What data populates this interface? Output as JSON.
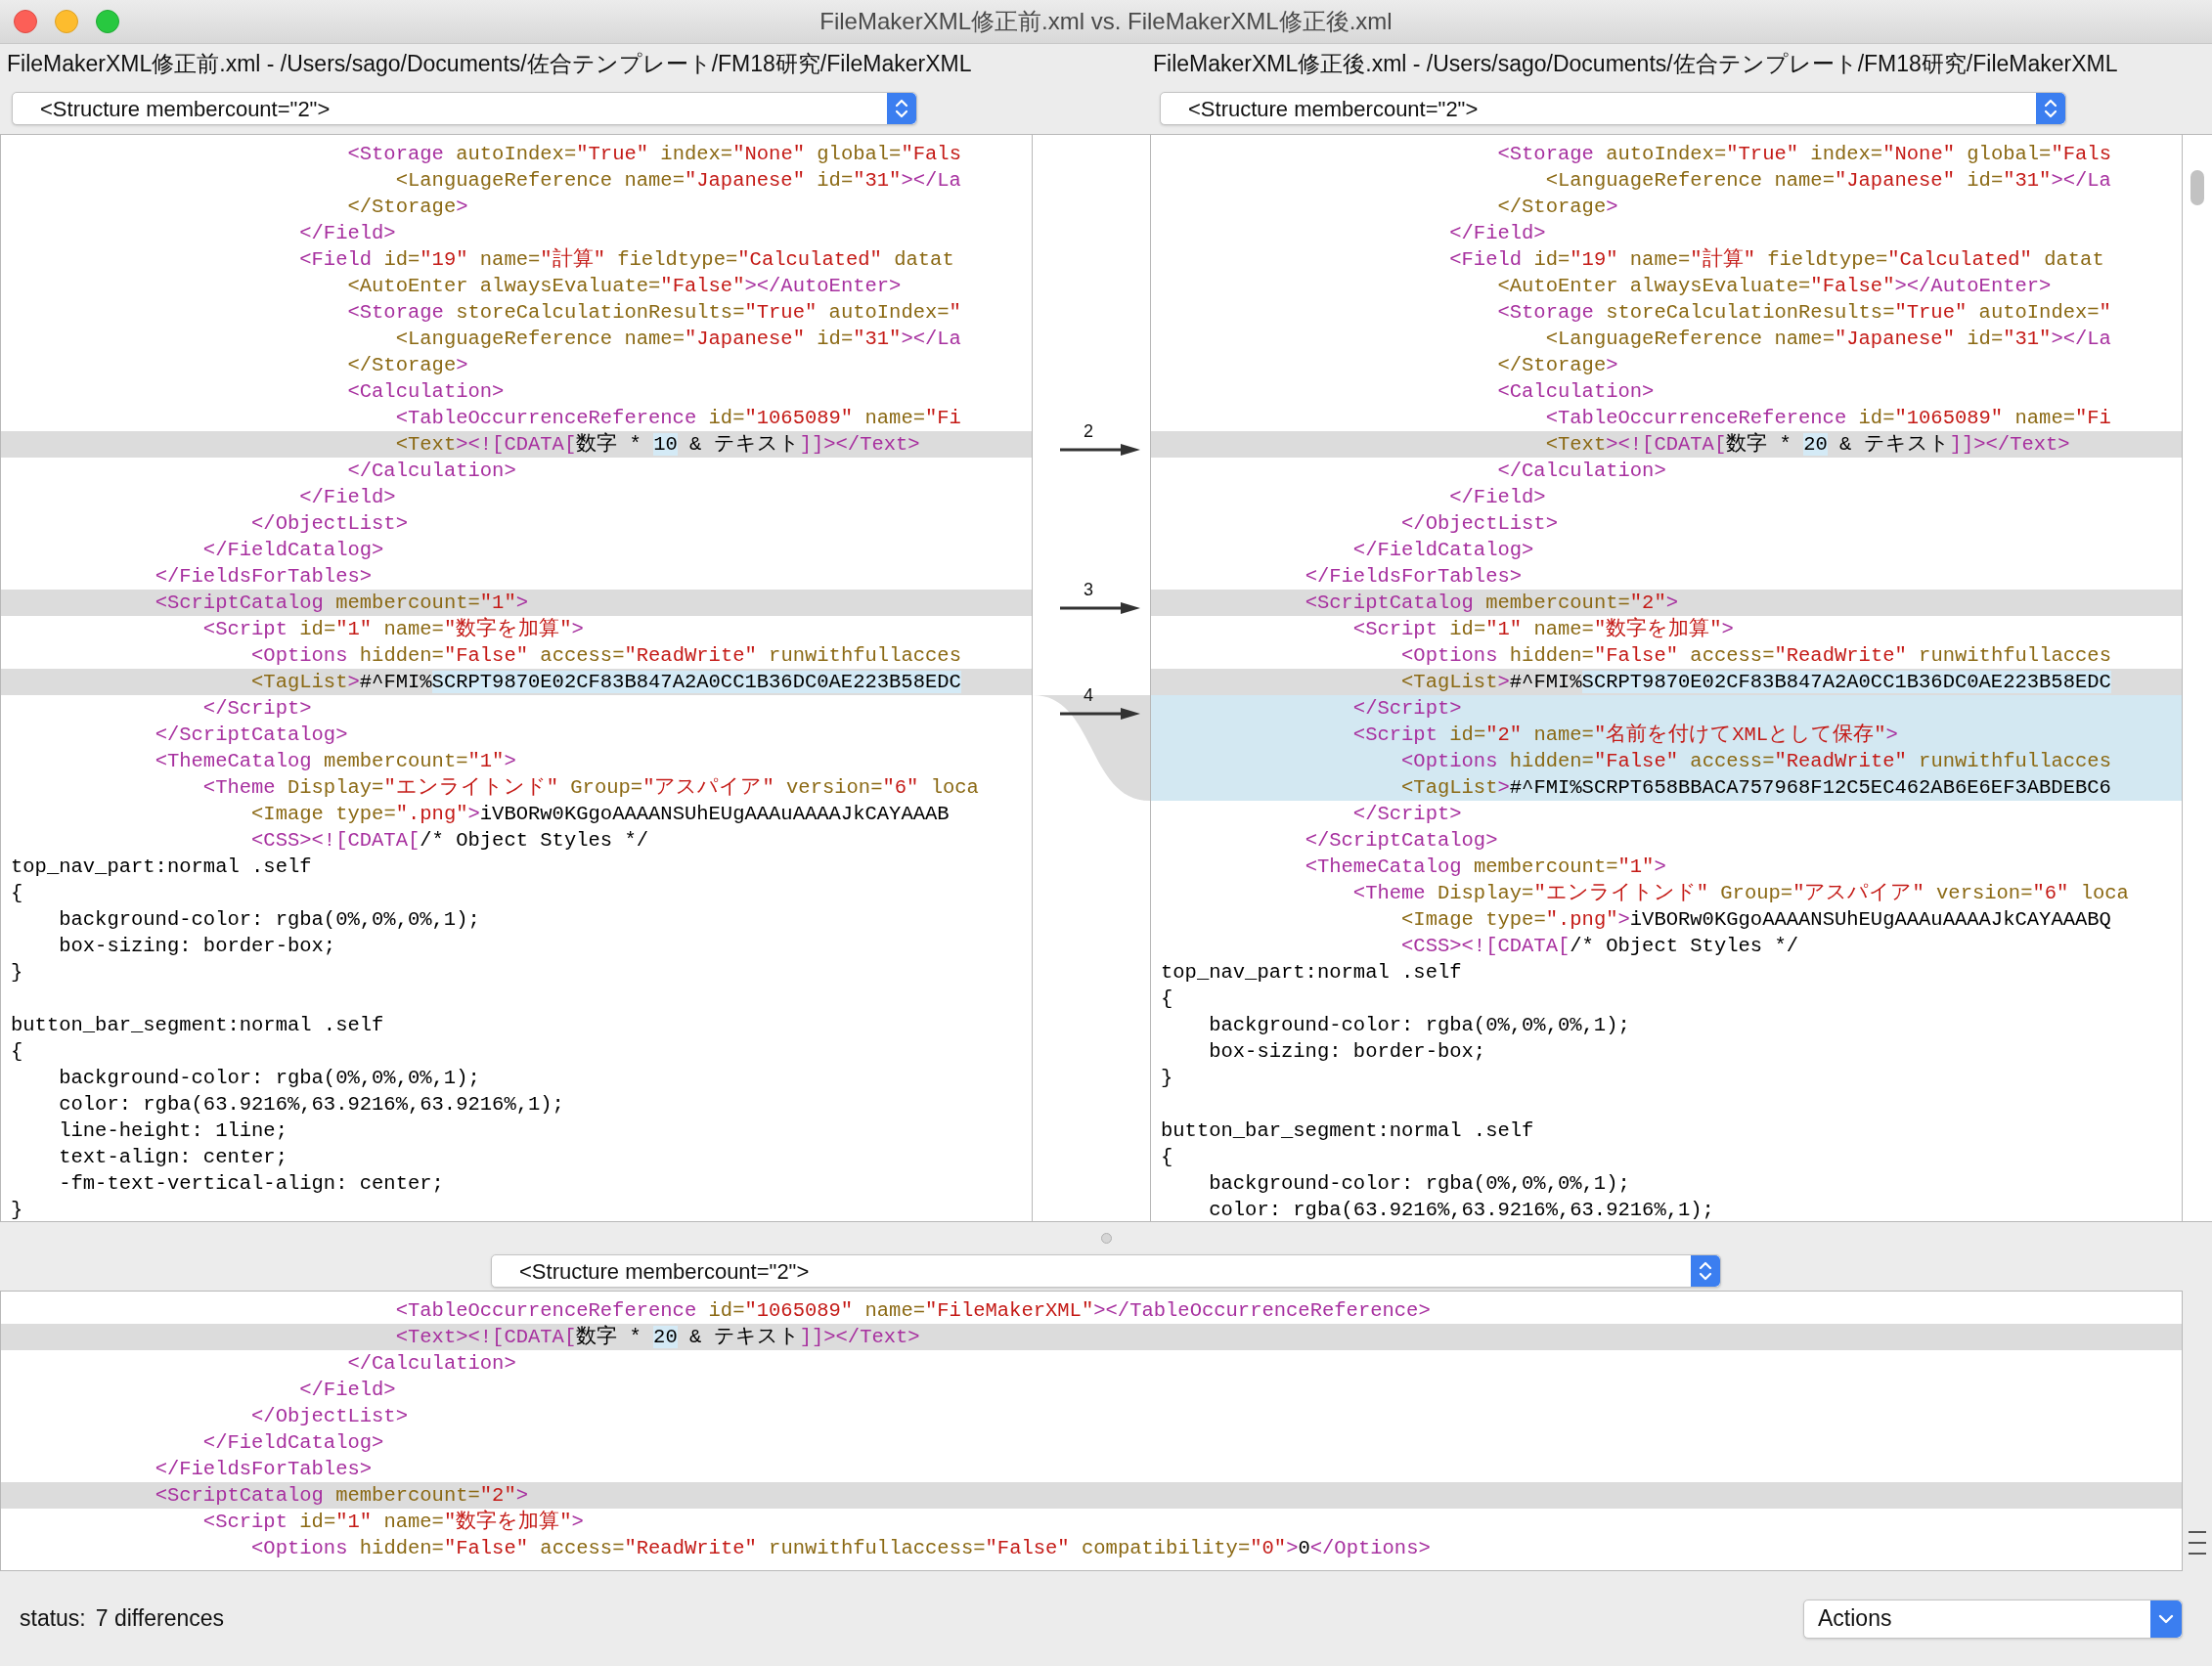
{
  "window": {
    "title": "FileMakerXML修正前.xml vs. FileMakerXML修正後.xml"
  },
  "left": {
    "path": "FileMakerXML修正前.xml - /Users/sago/Documents/佐合テンプレート/FM18研究/FileMakerXML",
    "structure": "<Structure membercount=\"2\">",
    "lines": [
      {
        "text": "                            <Storage autoIndex=\"True\" index=\"None\" global=\"Fals",
        "changed": false,
        "added": false
      },
      {
        "text": "                                <LanguageReference name=\"Japanese\" id=\"31\"></La",
        "changed": false,
        "added": false
      },
      {
        "text": "                            </Storage>",
        "changed": false,
        "added": false
      },
      {
        "text": "                        </Field>",
        "changed": false,
        "added": false
      },
      {
        "text": "                        <Field id=\"19\" name=\"計算\" fieldtype=\"Calculated\" datat",
        "changed": false,
        "added": false
      },
      {
        "text": "                            <AutoEnter alwaysEvaluate=\"False\"></AutoEnter>",
        "changed": false,
        "added": false
      },
      {
        "text": "                            <Storage storeCalculationResults=\"True\" autoIndex=\"",
        "changed": false,
        "added": false
      },
      {
        "text": "                                <LanguageReference name=\"Japanese\" id=\"31\"></La",
        "changed": false,
        "added": false
      },
      {
        "text": "                            </Storage>",
        "changed": false,
        "added": false
      },
      {
        "text": "                            <Calculation>",
        "changed": false,
        "added": false
      },
      {
        "text": "                                <TableOccurrenceReference id=\"1065089\" name=\"Fi",
        "changed": false,
        "added": false
      },
      {
        "segments": [
          {
            "text": "                                <Text><![CDATA[数字 * ",
            "highlight": false
          },
          {
            "text": "10",
            "highlight": true
          },
          {
            "text": " & テキスト]]></Text>",
            "highlight": false
          }
        ],
        "changed": true,
        "added": false
      },
      {
        "text": "                            </Calculation>",
        "changed": false,
        "added": false
      },
      {
        "text": "                        </Field>",
        "changed": false,
        "added": false
      },
      {
        "text": "                    </ObjectList>",
        "changed": false,
        "added": false
      },
      {
        "text": "                </FieldCatalog>",
        "changed": false,
        "added": false
      },
      {
        "text": "            </FieldsForTables>",
        "changed": false,
        "added": false
      },
      {
        "text": "            <ScriptCatalog membercount=\"1\">",
        "changed": true,
        "added": false
      },
      {
        "text": "                <Script id=\"1\" name=\"数字を加算\">",
        "changed": false,
        "added": false
      },
      {
        "text": "                    <Options hidden=\"False\" access=\"ReadWrite\" runwithfullacces",
        "changed": false,
        "added": false
      },
      {
        "segments": [
          {
            "text": "                    <TagList>#^FMI%",
            "highlight": false
          },
          {
            "text": "SCRPT9870E02CF83B847A2A0CC1B36DC0AE223B58EDC",
            "highlight": true
          }
        ],
        "changed": true,
        "added": false
      },
      {
        "text": "                </Script>",
        "changed": false,
        "added": false
      },
      {
        "text": "            </ScriptCatalog>",
        "changed": false,
        "added": false
      },
      {
        "text": "            <ThemeCatalog membercount=\"1\">",
        "changed": false,
        "added": false
      },
      {
        "text": "                <Theme Display=\"エンライトンド\" Group=\"アスパイア\" version=\"6\" loca",
        "changed": false,
        "added": false
      },
      {
        "text": "                    <Image type=\".png\">iVBORw0KGgoAAAANSUhEUgAAAuAAAAJkCAYAAAB",
        "changed": false,
        "added": false
      },
      {
        "text": "                    <CSS><![CDATA[/* Object Styles */",
        "changed": false,
        "added": false
      },
      {
        "text": "top_nav_part:normal .self",
        "changed": false,
        "added": false
      },
      {
        "text": "{",
        "changed": false,
        "added": false
      },
      {
        "text": "    background-color: rgba(0%,0%,0%,1);",
        "changed": false,
        "added": false
      },
      {
        "text": "    box-sizing: border-box;",
        "changed": false,
        "added": false
      },
      {
        "text": "}",
        "changed": false,
        "added": false
      },
      {
        "kind": "blank",
        "changed": false,
        "added": false
      },
      {
        "text": "button_bar_segment:normal .self",
        "changed": false,
        "added": false
      },
      {
        "text": "{",
        "changed": false,
        "added": false
      },
      {
        "text": "    background-color: rgba(0%,0%,0%,1);",
        "changed": false,
        "added": false
      },
      {
        "text": "    color: rgba(63.9216%,63.9216%,63.9216%,1);",
        "changed": false,
        "added": false
      },
      {
        "text": "    line-height: 1line;",
        "changed": false,
        "added": false
      },
      {
        "text": "    text-align: center;",
        "changed": false,
        "added": false
      },
      {
        "text": "    -fm-text-vertical-align: center;",
        "changed": false,
        "added": false
      },
      {
        "text": "}",
        "changed": false,
        "added": false
      }
    ]
  },
  "right": {
    "path": "FileMakerXML修正後.xml - /Users/sago/Documents/佐合テンプレート/FM18研究/FileMakerXML",
    "structure": "<Structure membercount=\"2\">",
    "lines": [
      {
        "text": "                            <Storage autoIndex=\"True\" index=\"None\" global=\"Fals",
        "changed": false,
        "added": false
      },
      {
        "text": "                                <LanguageReference name=\"Japanese\" id=\"31\"></La",
        "changed": false,
        "added": false
      },
      {
        "text": "                            </Storage>",
        "changed": false,
        "added": false
      },
      {
        "text": "                        </Field>",
        "changed": false,
        "added": false
      },
      {
        "text": "                        <Field id=\"19\" name=\"計算\" fieldtype=\"Calculated\" datat",
        "changed": false,
        "added": false
      },
      {
        "text": "                            <AutoEnter alwaysEvaluate=\"False\"></AutoEnter>",
        "changed": false,
        "added": false
      },
      {
        "text": "                            <Storage storeCalculationResults=\"True\" autoIndex=\"",
        "changed": false,
        "added": false
      },
      {
        "text": "                                <LanguageReference name=\"Japanese\" id=\"31\"></La",
        "changed": false,
        "added": false
      },
      {
        "text": "                            </Storage>",
        "changed": false,
        "added": false
      },
      {
        "text": "                            <Calculation>",
        "changed": false,
        "added": false
      },
      {
        "text": "                                <TableOccurrenceReference id=\"1065089\" name=\"Fi",
        "changed": false,
        "added": false
      },
      {
        "segments": [
          {
            "text": "                                <Text><![CDATA[数字 * ",
            "highlight": false
          },
          {
            "text": "20",
            "highlight": true
          },
          {
            "text": " & テキスト]]></Text>",
            "highlight": false
          }
        ],
        "changed": true,
        "added": false,
        "diff": "2"
      },
      {
        "text": "                            </Calculation>",
        "changed": false,
        "added": false
      },
      {
        "text": "                        </Field>",
        "changed": false,
        "added": false
      },
      {
        "text": "                    </ObjectList>",
        "changed": false,
        "added": false
      },
      {
        "text": "                </FieldCatalog>",
        "changed": false,
        "added": false
      },
      {
        "text": "            </FieldsForTables>",
        "changed": false,
        "added": false
      },
      {
        "text": "            <ScriptCatalog membercount=\"2\">",
        "changed": true,
        "added": false,
        "diff": "3"
      },
      {
        "text": "                <Script id=\"1\" name=\"数字を加算\">",
        "changed": false,
        "added": false
      },
      {
        "text": "                    <Options hidden=\"False\" access=\"ReadWrite\" runwithfullacces",
        "changed": false,
        "added": false
      },
      {
        "segments": [
          {
            "text": "                    <TagList>#^FMI%",
            "highlight": false
          },
          {
            "text": "SCRPT9870E02CF83B847A2A0CC1B36DC0AE223B58EDC",
            "highlight": true
          }
        ],
        "changed": true,
        "added": false
      },
      {
        "text": "                </Script>",
        "changed": false,
        "added": true,
        "diff": "4"
      },
      {
        "text": "                <Script id=\"2\" name=\"名前を付けてXMLとして保存\">",
        "changed": false,
        "added": true
      },
      {
        "text": "                    <Options hidden=\"False\" access=\"ReadWrite\" runwithfullacces",
        "changed": false,
        "added": true
      },
      {
        "text": "                    <TagList>#^FMI%SCRPT658BBACA757968F12C5EC462AB6E6EF3ABDEBC6",
        "changed": false,
        "added": true
      },
      {
        "text": "                </Script>",
        "changed": false,
        "added": false
      },
      {
        "text": "            </ScriptCatalog>",
        "changed": false,
        "added": false
      },
      {
        "text": "            <ThemeCatalog membercount=\"1\">",
        "changed": false,
        "added": false
      },
      {
        "text": "                <Theme Display=\"エンライトンド\" Group=\"アスパイア\" version=\"6\" loca",
        "changed": false,
        "added": false
      },
      {
        "text": "                    <Image type=\".png\">iVBORw0KGgoAAAANSUhEUgAAAuAAAAJkCAYAAABQ",
        "changed": false,
        "added": false
      },
      {
        "text": "                    <CSS><![CDATA[/* Object Styles */",
        "changed": false,
        "added": false
      },
      {
        "text": "top_nav_part:normal .self",
        "changed": false,
        "added": false
      },
      {
        "text": "{",
        "changed": false,
        "added": false
      },
      {
        "text": "    background-color: rgba(0%,0%,0%,1);",
        "changed": false,
        "added": false
      },
      {
        "text": "    box-sizing: border-box;",
        "changed": false,
        "added": false
      },
      {
        "text": "}",
        "changed": false,
        "added": false
      },
      {
        "kind": "blank",
        "changed": false,
        "added": false
      },
      {
        "text": "button_bar_segment:normal .self",
        "changed": false,
        "added": false
      },
      {
        "text": "{",
        "changed": false,
        "added": false
      },
      {
        "text": "    background-color: rgba(0%,0%,0%,1);",
        "changed": false,
        "added": false
      },
      {
        "text": "    color: rgba(63.9216%,63.9216%,63.9216%,1);",
        "changed": false,
        "added": false
      }
    ]
  },
  "merge": {
    "structure": "<Structure membercount=\"2\">",
    "lines": [
      {
        "text": "                                <TableOccurrenceReference id=\"1065089\" name=\"FileMakerXML\"></TableOccurrenceReference>",
        "changed": false,
        "added": false
      },
      {
        "segments": [
          {
            "text": "                                <Text><![CDATA[数字 * ",
            "highlight": false
          },
          {
            "text": "20",
            "highlight": true
          },
          {
            "text": " & テキスト]]></Text>",
            "highlight": false
          }
        ],
        "changed": true,
        "added": false
      },
      {
        "text": "                            </Calculation>",
        "changed": false,
        "added": false
      },
      {
        "text": "                        </Field>",
        "changed": false,
        "added": false
      },
      {
        "text": "                    </ObjectList>",
        "changed": false,
        "added": false
      },
      {
        "text": "                </FieldCatalog>",
        "changed": false,
        "added": false
      },
      {
        "text": "            </FieldsForTables>",
        "changed": false,
        "added": false
      },
      {
        "text": "            <ScriptCatalog membercount=\"2\">",
        "changed": true,
        "added": false
      },
      {
        "text": "                <Script id=\"1\" name=\"数字を加算\">",
        "changed": false,
        "added": false
      },
      {
        "text": "                    <Options hidden=\"False\" access=\"ReadWrite\" runwithfullaccess=\"False\" compatibility=\"0\">0</Options>",
        "changed": false,
        "added": false
      }
    ]
  },
  "status": {
    "label": "status:",
    "value": "7 differences"
  },
  "actions": {
    "label": "Actions"
  }
}
